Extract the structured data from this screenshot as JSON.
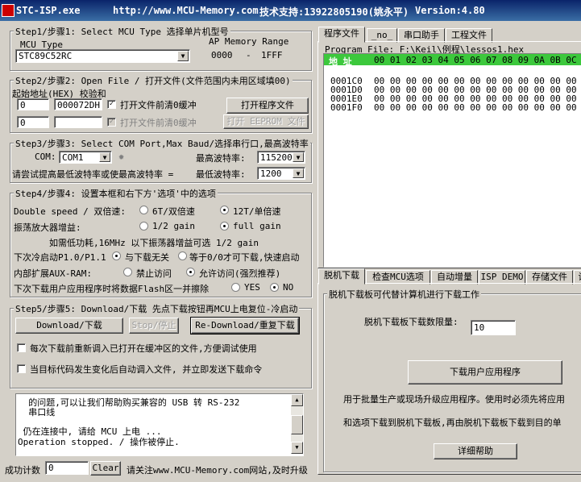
{
  "title": {
    "app": "STC-ISP.exe",
    "url": "http://www.MCU-Memory.com",
    "support": "技术支持:13922805190(姚永平)",
    "version": "Version:4.80"
  },
  "step1": {
    "caption": "Step1/步骤1: Select MCU Type  选择单片机型号",
    "mcu_type_label": "MCU Type",
    "mcu_type_value": "STC89C52RC",
    "ap_memory_label": "AP Memory Range",
    "ap_start": "0000",
    "ap_dash": "-",
    "ap_end": "1FFF"
  },
  "step2": {
    "caption": "Step2/步骤2: Open File / 打开文件(文件范围内未用区域填00)",
    "address_label": "起始地址(HEX) 校验和",
    "addr1": "0",
    "checksum1": "000072DH",
    "clear_before_open_label": "打开文件前清0缓冲",
    "open_program_file": "打开程序文件",
    "addr2": "0",
    "checksum2": "",
    "clear_before_open2_label": "打开文件前清0缓冲",
    "open_eeprom_file": "打开 EEPROM 文件"
  },
  "step3": {
    "caption": "Step3/步骤3: Select COM Port,Max Baud/选择串行口,最高波特率",
    "com_label": "COM:",
    "com_value": "COM1",
    "max_baud_label": "最高波特率:",
    "max_baud_value": "115200",
    "hint": "请尝试提高最低波特率或使最高波特率 =",
    "min_baud_label": "最低波特率:",
    "min_baud_value": "1200"
  },
  "step4": {
    "caption": "Step4/步骤4: 设置本框和右下方'选项'中的选项",
    "double_speed_label": "Double speed / 双倍速:",
    "opt_6t": "6T/双倍速",
    "opt_12t": "12T/单倍速",
    "amp_label": "振荡放大器增益:",
    "opt_half_gain": "1/2 gain",
    "opt_full_gain": "full gain",
    "amp_note": "如需低功耗,16MHz 以下振荡器增益可选 1/2 gain",
    "cold_start_label": "下次冷启动P1.0/P1.1",
    "opt_no_relation": "与下载无关",
    "opt_equal_zero": "等于0/0才可下载,快速启动",
    "aux_ram_label": "内部扩展AUX-RAM:",
    "opt_deny": "禁止访问",
    "opt_allow": "允许访问(强烈推荐)",
    "flash_erase_label": "下次下载用户应用程序时将数据Flash区一并擦除",
    "opt_yes": "YES",
    "opt_no": "NO"
  },
  "step5": {
    "caption": "Step5/步骤5: Download/下载  先点下载按钮再MCU上电复位-冷启动",
    "download": "Download/下载",
    "stop": "Stop/停止",
    "redownload": "Re-Download/重复下载",
    "reload_label": "每次下载前重新调入已打开在缓冲区的文件,方便调试使用",
    "auto_load_label": "当目标代码发生变化后自动调入文件, 并立即发送下载命令"
  },
  "log": {
    "lines": [
      "  的问题,可以让我们帮助购买兼容的 USB 转 RS-232",
      "  串口线",
      "",
      " 仍在连接中, 请给 MCU 上电 ...",
      "Operation stopped. / 操作被停止."
    ]
  },
  "bottom": {
    "success_count_label": "成功计数",
    "success_count_value": "0",
    "clear": "Clear",
    "notice": "请关注www.MCU-Memory.com网站,及时升级"
  },
  "right_tabs": [
    "程序文件",
    "_no_",
    "串口助手",
    "工程文件"
  ],
  "program_file": {
    "label": "Program File: F:\\Keil\\例程\\lessos1.hex",
    "header_addr": "地 址",
    "header_cols": "00 01 02 03 04 05 06 07 08 09 0A 0B 0C 0D 0",
    "rows": [
      {
        "addr": "0001C0",
        "bytes": "00 00 00 00 00 00 00 00 00 00 00 00 00 00 0"
      },
      {
        "addr": "0001D0",
        "bytes": "00 00 00 00 00 00 00 00 00 00 00 00 00 00 0"
      },
      {
        "addr": "0001E0",
        "bytes": "00 00 00 00 00 00 00 00 00 00 00 00 00 00 0"
      },
      {
        "addr": "0001F0",
        "bytes": "00 00 00 00 00 00 00 00 00 00 00 00 00 00 0"
      }
    ]
  },
  "lower_tabs": [
    "脱机下载",
    "检查MCU选项",
    "自动增量",
    "ISP DEMO",
    "存储文件",
    "设"
  ],
  "offline": {
    "caption": "脱机下载板可代替计算机进行下载工作",
    "limit_label": "脱机下载板下载数限量:",
    "limit_value": "10",
    "download_user_app": "下载用户应用程序",
    "desc1": "用于批量生产或现场升级应用程序。使用时必须先将应用",
    "desc2": "和选项下载到脱机下载板,再由脱机下载板下载到目的单",
    "help": "详细帮助"
  }
}
